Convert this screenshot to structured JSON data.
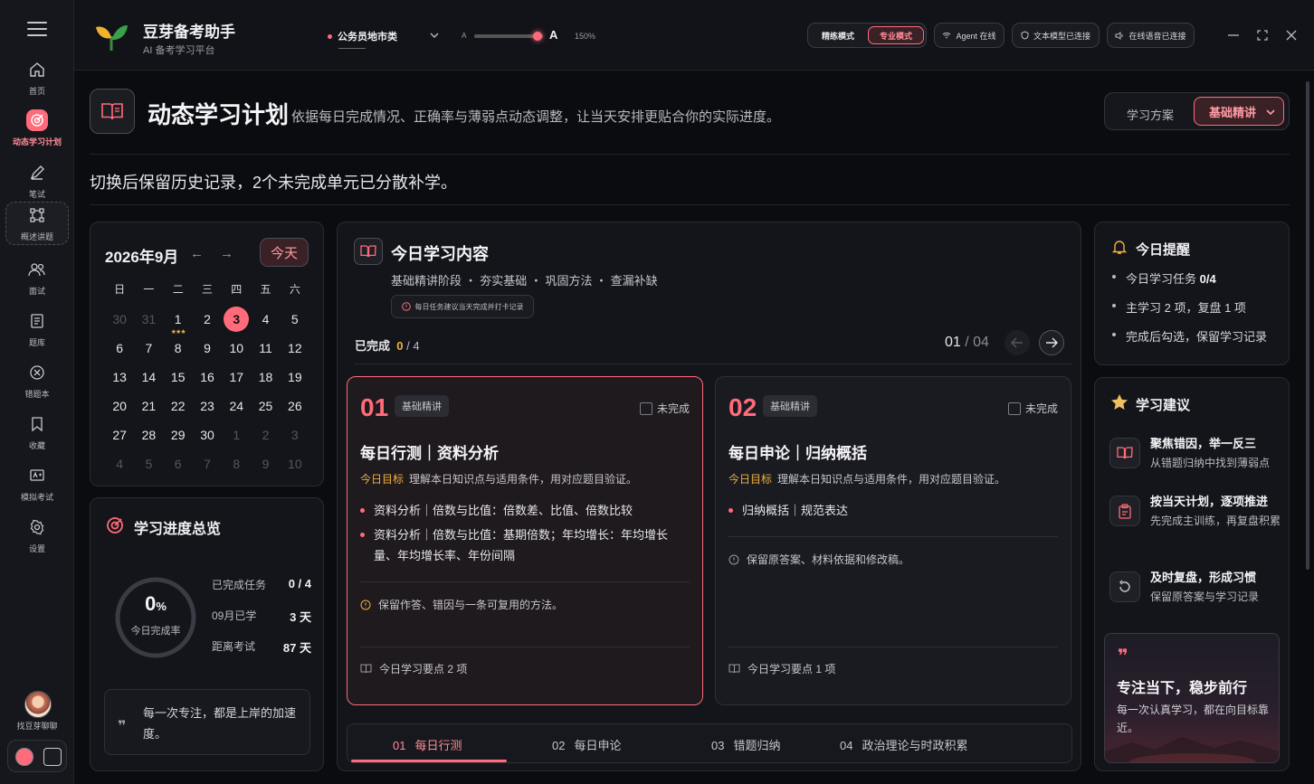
{
  "app": {
    "name": "豆芽备考助手",
    "subtitle": "AI 备考学习平台"
  },
  "topbar": {
    "exam_select": "公务员地市类",
    "font_small": "A",
    "font_large": "A",
    "zoom": "150%",
    "font_scale_level_percent": 100,
    "mode_practice": "精练模式",
    "mode_pro": "专业模式",
    "status_agent": "Agent 在线",
    "status_text_model": "文本模型已连接",
    "status_voice": "在线语音已连接"
  },
  "nav": {
    "items": [
      {
        "label": "首页",
        "icon": "home-icon"
      },
      {
        "label": "动态学习计划",
        "icon": "target-icon"
      },
      {
        "label": "笔试",
        "icon": "pen-icon"
      },
      {
        "label": "概述讲题",
        "icon": "nodes-icon"
      },
      {
        "label": "面试",
        "icon": "people-icon"
      },
      {
        "label": "题库",
        "icon": "book-icon"
      },
      {
        "label": "错题本",
        "icon": "x-circle-icon"
      },
      {
        "label": "收藏",
        "icon": "bookmark-icon"
      },
      {
        "label": "模拟考试",
        "icon": "exam-icon"
      },
      {
        "label": "设置",
        "icon": "gear-icon"
      }
    ],
    "chat_label": "找豆芽聊聊"
  },
  "header": {
    "title": "动态学习计划",
    "description": "依据每日完成情况、正确率与薄弱点动态调整，让当天安排更贴合你的实际进度。",
    "plan_label": "学习方案",
    "plan_value": "基础精讲",
    "notice": "切换后保留历史记录，2个未完成单元已分散补学。"
  },
  "calendar": {
    "title": "2026年9月",
    "today_button": "今天",
    "weekdays": [
      "日",
      "一",
      "二",
      "三",
      "四",
      "五",
      "六"
    ],
    "weeks": [
      [
        "30",
        "31",
        "1",
        "2",
        "3",
        "4",
        "5"
      ],
      [
        "6",
        "7",
        "8",
        "9",
        "10",
        "11",
        "12"
      ],
      [
        "13",
        "14",
        "15",
        "16",
        "17",
        "18",
        "19"
      ],
      [
        "20",
        "21",
        "22",
        "23",
        "24",
        "25",
        "26"
      ],
      [
        "27",
        "28",
        "29",
        "30",
        "1",
        "2",
        "3"
      ],
      [
        "4",
        "5",
        "6",
        "7",
        "8",
        "9",
        "10"
      ]
    ],
    "today": "3",
    "starred_day": "1",
    "stars": "★★★"
  },
  "progress": {
    "title": "学习进度总览",
    "percent_value": "0",
    "percent_unit": "%",
    "percent_label": "今日完成率",
    "completion_fraction": 0,
    "stats": [
      {
        "label": "已完成任务",
        "value": "0 / 4"
      },
      {
        "label": "09月已学",
        "value": "3 天"
      },
      {
        "label": "距离考试",
        "value": "87 天"
      }
    ],
    "quote": "每一次专注，都是上岸的加速度。"
  },
  "today": {
    "title": "今日学习内容",
    "subtitle": "基础精讲阶段 ・ 夯实基础 ・ 巩固方法 ・ 查漏补缺",
    "tip": "每日任务建议当天完成并打卡记录",
    "done_label": "已完成",
    "done_count": "0",
    "done_total": "/ 4",
    "pager_current": "01",
    "pager_total": "/ 04",
    "cards": [
      {
        "no": "01",
        "tag": "基础精讲",
        "status": "未完成",
        "title": "每日行测｜资料分析",
        "goal_label": "今日目标",
        "goal": "理解本日知识点与适用条件，用对应题目验证。",
        "points": [
          "资料分析｜倍数与比值：倍数差、比值、倍数比较",
          "资料分析｜倍数与比值：基期倍数；年均增长：年均增长量、年均增长率、年份间隔"
        ],
        "note": "保留作答、错因与一条可复用的方法。",
        "footer": "今日学习要点 2 项"
      },
      {
        "no": "02",
        "tag": "基础精讲",
        "status": "未完成",
        "title": "每日申论｜归纳概括",
        "goal_label": "今日目标",
        "goal": "理解本日知识点与适用条件，用对应题目验证。",
        "points": [
          "归纳概括｜规范表达"
        ],
        "note": "保留原答案、材料依据和修改稿。",
        "footer": "今日学习要点 1 项"
      }
    ],
    "tabs": [
      {
        "no": "01",
        "label": "每日行测"
      },
      {
        "no": "02",
        "label": "每日申论"
      },
      {
        "no": "03",
        "label": "错题归纳"
      },
      {
        "no": "04",
        "label": "政治理论与时政积累"
      }
    ]
  },
  "reminder": {
    "title": "今日提醒",
    "item1_prefix": "今日学习任务",
    "item1_value": "0/4",
    "item2": "主学习 2 项，复盘 1 项",
    "item3": "完成后勾选，保留学习记录"
  },
  "suggestions": {
    "title": "学习建议",
    "items": [
      {
        "title": "聚焦错因，举一反三",
        "desc": "从错题归纳中找到薄弱点",
        "icon": "book-open-icon"
      },
      {
        "title": "按当天计划，逐项推进",
        "desc": "先完成主训练，再复盘积累",
        "icon": "clipboard-icon"
      },
      {
        "title": "及时复盘，形成习惯",
        "desc": "保留原答案与学习记录",
        "icon": "refresh-icon"
      }
    ],
    "motto_title": "专注当下，稳步前行",
    "motto_desc": "每一次认真学习，都在向目标靠近。"
  },
  "colors": {
    "accent": "#ff6b7a",
    "gold": "#f0b040",
    "background": "#0b0c10",
    "panel": "#14151a"
  }
}
